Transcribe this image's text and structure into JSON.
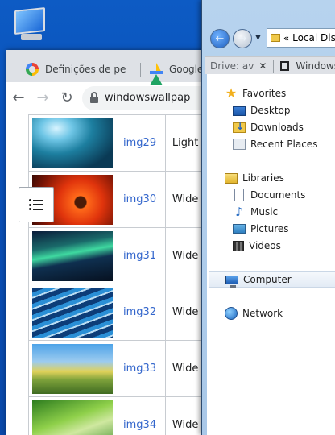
{
  "desktop": {
    "icon": "computer-icon"
  },
  "chrome": {
    "tabs": [
      {
        "title": "Definições de pe",
        "icon": "google-icon"
      },
      {
        "title": "Google",
        "icon": "google-drive-icon"
      }
    ],
    "address": "windowswallpap",
    "images": [
      {
        "name": "img29",
        "desc": "Light"
      },
      {
        "name": "img30",
        "desc": "Wide"
      },
      {
        "name": "img31",
        "desc": "Wide"
      },
      {
        "name": "img32",
        "desc": "Wide"
      },
      {
        "name": "img33",
        "desc": "Wide"
      },
      {
        "name": "img34",
        "desc": "Wide"
      }
    ]
  },
  "explorer": {
    "tab_fragment": "Drive: av",
    "tab_title": "Windows",
    "address": "Local Dis",
    "address_chevron": "«",
    "favorites": {
      "label": "Favorites",
      "items": [
        "Desktop",
        "Downloads",
        "Recent Places"
      ]
    },
    "libraries": {
      "label": "Libraries",
      "items": [
        "Documents",
        "Music",
        "Pictures",
        "Videos"
      ]
    },
    "computer": "Computer",
    "network": "Network"
  }
}
